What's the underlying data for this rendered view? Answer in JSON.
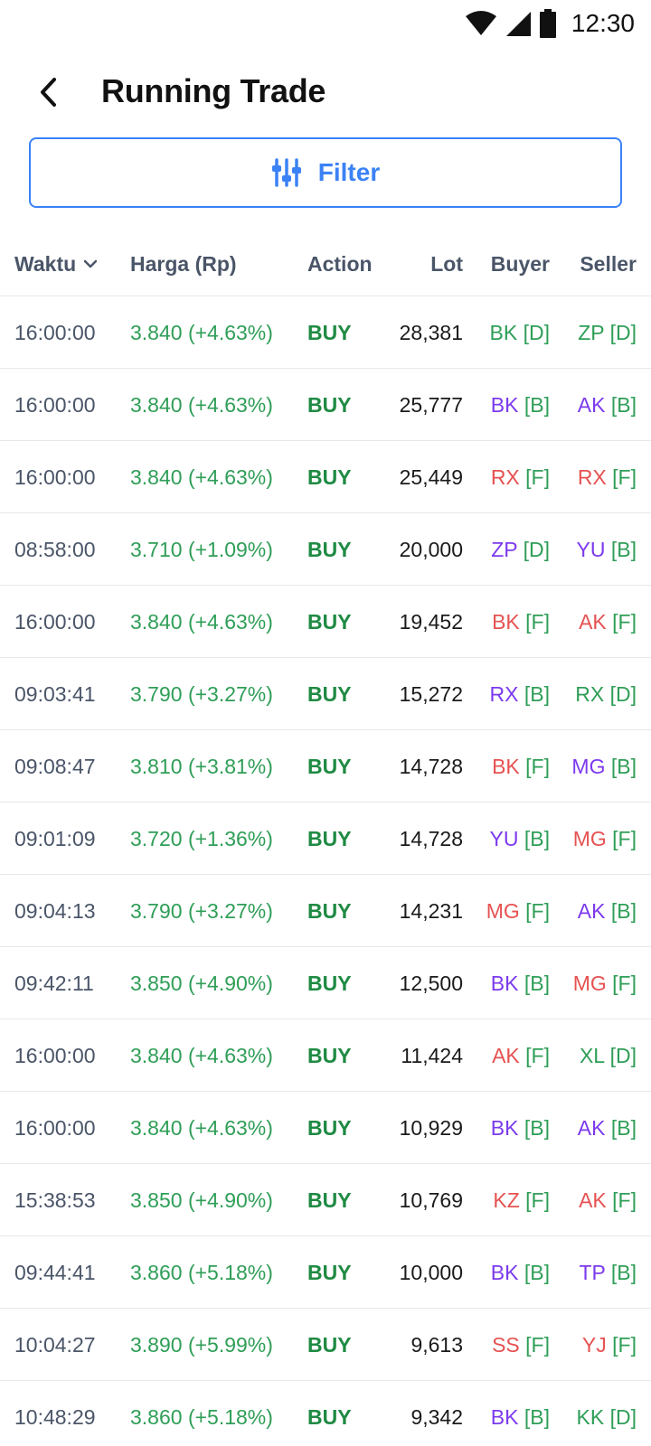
{
  "status_bar": {
    "time": "12:30"
  },
  "header": {
    "title": "Running Trade"
  },
  "filter": {
    "label": "Filter"
  },
  "columns": {
    "waktu": "Waktu",
    "harga": "Harga (Rp)",
    "action": "Action",
    "lot": "Lot",
    "buyer": "Buyer",
    "seller": "Seller"
  },
  "rows": [
    {
      "time": "16:00:00",
      "price": "3.840 (+4.63%)",
      "action": "BUY",
      "lot": "28,381",
      "buyer_code": "BK",
      "buyer_tag": "[D]",
      "buyer_type": "domestic",
      "seller_code": "ZP",
      "seller_tag": "[D]",
      "seller_type": "domestic"
    },
    {
      "time": "16:00:00",
      "price": "3.840 (+4.63%)",
      "action": "BUY",
      "lot": "25,777",
      "buyer_code": "BK",
      "buyer_tag": "[B]",
      "buyer_type": "bumn",
      "seller_code": "AK",
      "seller_tag": "[B]",
      "seller_type": "bumn"
    },
    {
      "time": "16:00:00",
      "price": "3.840 (+4.63%)",
      "action": "BUY",
      "lot": "25,449",
      "buyer_code": "RX",
      "buyer_tag": "[F]",
      "buyer_type": "foreign",
      "seller_code": "RX",
      "seller_tag": "[F]",
      "seller_type": "foreign"
    },
    {
      "time": "08:58:00",
      "price": "3.710 (+1.09%)",
      "action": "BUY",
      "lot": "20,000",
      "buyer_code": "ZP",
      "buyer_tag": "[D]",
      "buyer_type": "bumn",
      "seller_code": "YU",
      "seller_tag": "[B]",
      "seller_type": "bumn"
    },
    {
      "time": "16:00:00",
      "price": "3.840 (+4.63%)",
      "action": "BUY",
      "lot": "19,452",
      "buyer_code": "BK",
      "buyer_tag": "[F]",
      "buyer_type": "foreign",
      "seller_code": "AK",
      "seller_tag": "[F]",
      "seller_type": "foreign"
    },
    {
      "time": "09:03:41",
      "price": "3.790 (+3.27%)",
      "action": "BUY",
      "lot": "15,272",
      "buyer_code": "RX",
      "buyer_tag": "[B]",
      "buyer_type": "bumn",
      "seller_code": "RX",
      "seller_tag": "[D]",
      "seller_type": "domestic"
    },
    {
      "time": "09:08:47",
      "price": "3.810 (+3.81%)",
      "action": "BUY",
      "lot": "14,728",
      "buyer_code": "BK",
      "buyer_tag": "[F]",
      "buyer_type": "foreign",
      "seller_code": "MG",
      "seller_tag": "[B]",
      "seller_type": "bumn"
    },
    {
      "time": "09:01:09",
      "price": "3.720 (+1.36%)",
      "action": "BUY",
      "lot": "14,728",
      "buyer_code": "YU",
      "buyer_tag": "[B]",
      "buyer_type": "bumn",
      "seller_code": "MG",
      "seller_tag": "[F]",
      "seller_type": "foreign"
    },
    {
      "time": "09:04:13",
      "price": "3.790 (+3.27%)",
      "action": "BUY",
      "lot": "14,231",
      "buyer_code": "MG",
      "buyer_tag": "[F]",
      "buyer_type": "foreign",
      "seller_code": "AK",
      "seller_tag": "[B]",
      "seller_type": "bumn"
    },
    {
      "time": "09:42:11",
      "price": "3.850 (+4.90%)",
      "action": "BUY",
      "lot": "12,500",
      "buyer_code": "BK",
      "buyer_tag": "[B]",
      "buyer_type": "bumn",
      "seller_code": "MG",
      "seller_tag": "[F]",
      "seller_type": "foreign"
    },
    {
      "time": "16:00:00",
      "price": "3.840 (+4.63%)",
      "action": "BUY",
      "lot": "11,424",
      "buyer_code": "AK",
      "buyer_tag": "[F]",
      "buyer_type": "foreign",
      "seller_code": "XL",
      "seller_tag": "[D]",
      "seller_type": "domestic"
    },
    {
      "time": "16:00:00",
      "price": "3.840 (+4.63%)",
      "action": "BUY",
      "lot": "10,929",
      "buyer_code": "BK",
      "buyer_tag": "[B]",
      "buyer_type": "bumn",
      "seller_code": "AK",
      "seller_tag": "[B]",
      "seller_type": "bumn"
    },
    {
      "time": "15:38:53",
      "price": "3.850 (+4.90%)",
      "action": "BUY",
      "lot": "10,769",
      "buyer_code": "KZ",
      "buyer_tag": "[F]",
      "buyer_type": "foreign",
      "seller_code": "AK",
      "seller_tag": "[F]",
      "seller_type": "foreign"
    },
    {
      "time": "09:44:41",
      "price": "3.860 (+5.18%)",
      "action": "BUY",
      "lot": "10,000",
      "buyer_code": "BK",
      "buyer_tag": "[B]",
      "buyer_type": "bumn",
      "seller_code": "TP",
      "seller_tag": "[B]",
      "seller_type": "bumn"
    },
    {
      "time": "10:04:27",
      "price": "3.890 (+5.99%)",
      "action": "BUY",
      "lot": "9,613",
      "buyer_code": "SS",
      "buyer_tag": "[F]",
      "buyer_type": "foreign",
      "seller_code": "YJ",
      "seller_tag": "[F]",
      "seller_type": "foreign"
    },
    {
      "time": "10:48:29",
      "price": "3.860 (+5.18%)",
      "action": "BUY",
      "lot": "9,342",
      "buyer_code": "BK",
      "buyer_tag": "[B]",
      "buyer_type": "bumn",
      "seller_code": "KK",
      "seller_tag": "[D]",
      "seller_type": "domestic"
    }
  ]
}
